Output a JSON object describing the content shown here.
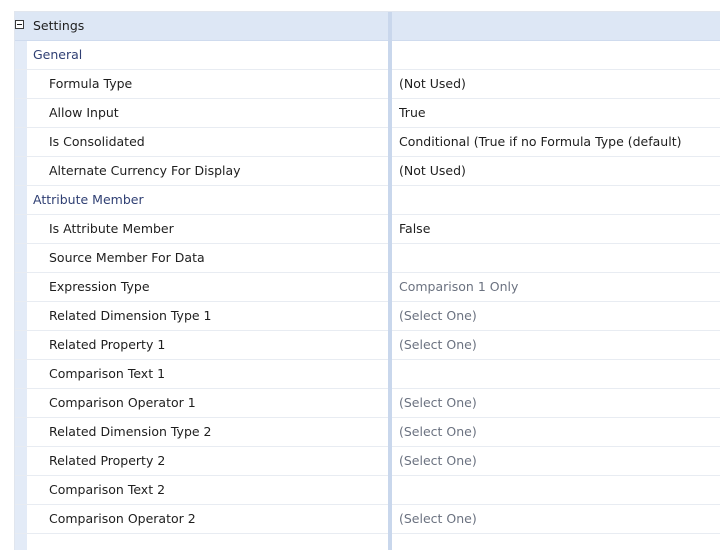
{
  "header": {
    "title": "Settings"
  },
  "categories": {
    "general": "General",
    "attribute_member": "Attribute Member"
  },
  "rows": [
    {
      "name": "Formula Type",
      "value": "(Not Used)"
    },
    {
      "name": "Allow Input",
      "value": "True"
    },
    {
      "name": "Is Consolidated",
      "value": "Conditional (True if no Formula Type (default)"
    },
    {
      "name": "Alternate Currency For Display",
      "value": "(Not Used)"
    },
    {
      "name": "Is Attribute Member",
      "value": "False"
    },
    {
      "name": "Source Member For Data",
      "value": ""
    },
    {
      "name": "Expression Type",
      "value": "Comparison 1 Only"
    },
    {
      "name": "Related Dimension Type 1",
      "value": "(Select One)"
    },
    {
      "name": "Related Property 1",
      "value": "(Select One)"
    },
    {
      "name": "Comparison Text 1",
      "value": ""
    },
    {
      "name": "Comparison Operator 1",
      "value": "(Select One)"
    },
    {
      "name": "Related Dimension Type 2",
      "value": "(Select One)"
    },
    {
      "name": "Related Property 2",
      "value": "(Select One)"
    },
    {
      "name": "Comparison Text 2",
      "value": ""
    },
    {
      "name": "Comparison Operator 2",
      "value": "(Select One)"
    }
  ]
}
